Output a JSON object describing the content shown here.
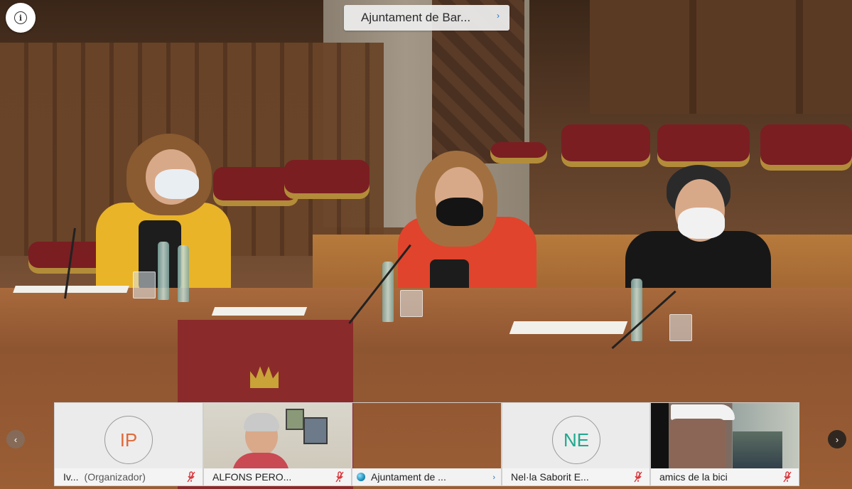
{
  "meeting": {
    "title": "Ajuntament de Bar...",
    "title_chevron": "›",
    "info_icon": "info-icon"
  },
  "navigation": {
    "prev_label": "‹",
    "next_label": "›"
  },
  "participants": [
    {
      "initials": "IP",
      "name": "Iv...",
      "role": "(Organizador)",
      "initials_color": "#e06a3a",
      "muted": true
    },
    {
      "name": "ALFONS PERO...",
      "muted": true
    },
    {
      "name": "Ajuntament de ...",
      "chevron": "›"
    },
    {
      "initials": "NE",
      "name": "Nel·la Saborit E...",
      "initials_color": "#1fa88e",
      "muted": true
    },
    {
      "name": "amics de la bici",
      "muted": true
    }
  ],
  "colors": {
    "muted_icon": "#d9343a",
    "accent": "#1a73c8"
  }
}
